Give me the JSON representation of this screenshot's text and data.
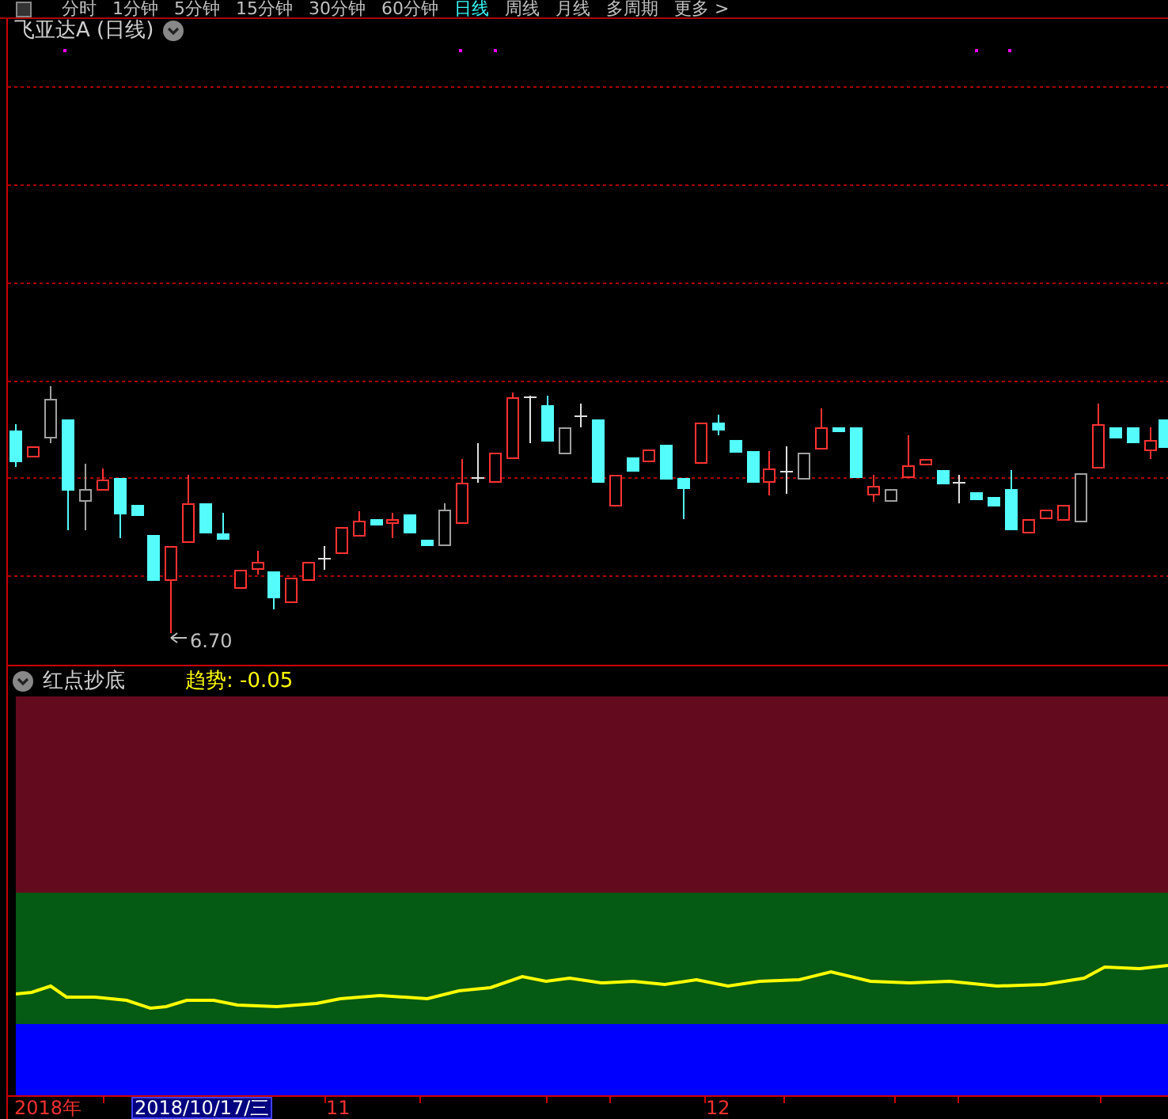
{
  "period_tabs": [
    {
      "label": "分时",
      "selected": false
    },
    {
      "label": "1分钟",
      "selected": false
    },
    {
      "label": "5分钟",
      "selected": false
    },
    {
      "label": "15分钟",
      "selected": false
    },
    {
      "label": "30分钟",
      "selected": false
    },
    {
      "label": "60分钟",
      "selected": false
    },
    {
      "label": "日线",
      "selected": true
    },
    {
      "label": "周线",
      "selected": false
    },
    {
      "label": "月线",
      "selected": false
    },
    {
      "label": "多周期",
      "selected": false
    },
    {
      "label": "更多 >",
      "selected": false
    }
  ],
  "main_chart": {
    "title": "飞亚达A (日线)",
    "low_label": "6.70"
  },
  "indicator": {
    "name": "红点抄底",
    "reading": "趋势: -0.05"
  },
  "time_axis": [
    {
      "label": "2018年",
      "kind": "year"
    },
    {
      "label": "2018/10/17/三",
      "kind": "cursor"
    },
    {
      "label": "11",
      "kind": "month"
    },
    {
      "label": "12",
      "kind": "month"
    }
  ]
}
